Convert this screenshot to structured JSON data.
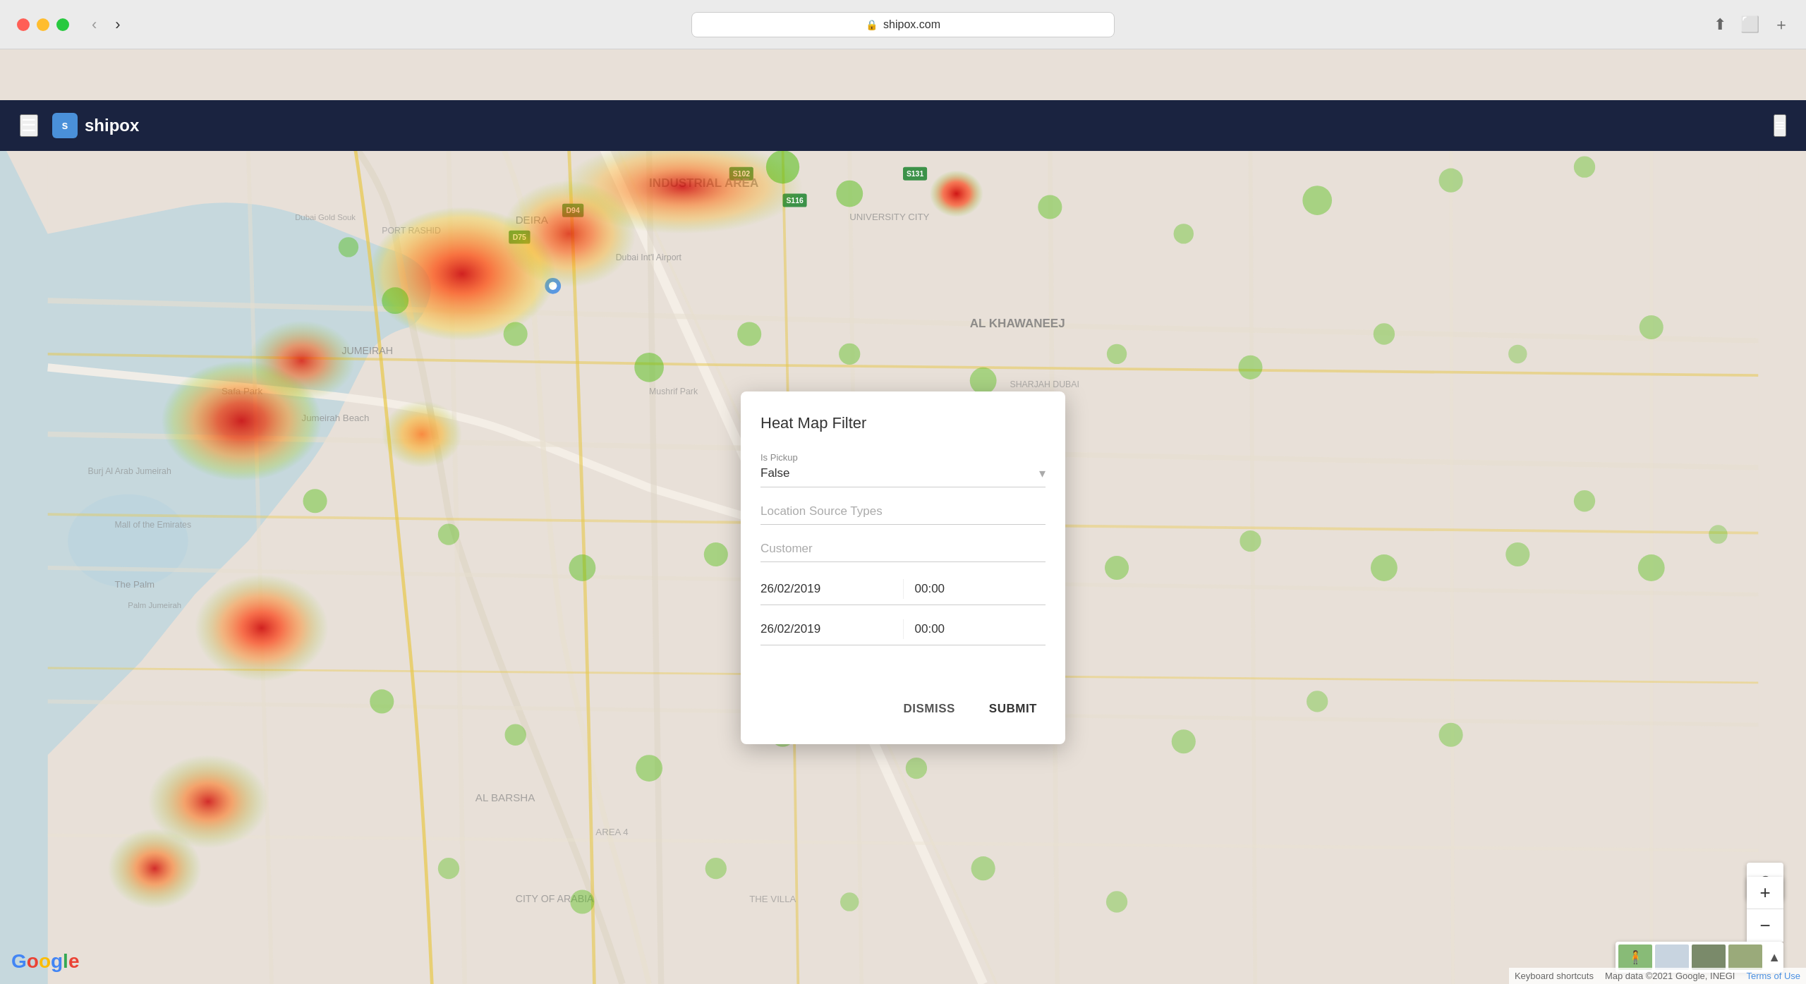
{
  "browser": {
    "url": "shipox.com",
    "lock_icon": "🔒"
  },
  "nav": {
    "logo_text": "shipox",
    "logo_letter": "s",
    "menu_icon": "☰",
    "hamburger_icon": "≡"
  },
  "modal": {
    "title": "Heat Map Filter",
    "is_pickup_label": "Is Pickup",
    "is_pickup_value": "False",
    "location_source_types_placeholder": "Location Source Types",
    "customer_placeholder": "Customer",
    "date_from": "26/02/2019",
    "time_from": "00:00",
    "date_to": "26/02/2019",
    "time_to": "00:00",
    "dismiss_label": "DISMISS",
    "submit_label": "SUBMIT"
  },
  "map": {
    "attribution_keyboard": "Keyboard shortcuts",
    "attribution_data": "Map data ©2021 Google, INEGI",
    "attribution_terms": "Terms of Use"
  },
  "controls": {
    "location_btn": "◎",
    "zoom_in": "+",
    "zoom_out": "−"
  }
}
